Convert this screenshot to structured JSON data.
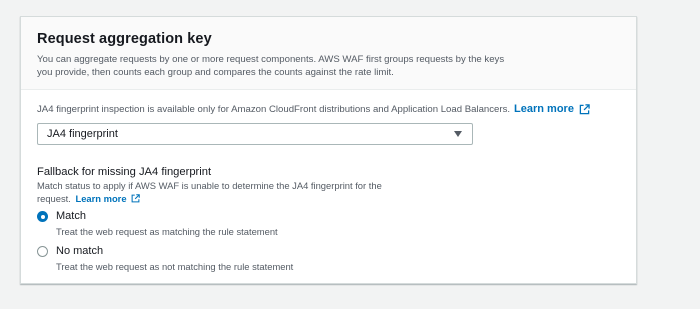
{
  "header": {
    "title": "Request aggregation key",
    "description": "You can aggregate requests by one or more request components. AWS WAF first groups requests by the keys you provide, then counts each group and compares the counts against the rate limit."
  },
  "info": {
    "text": "JA4 fingerprint inspection is available only for Amazon CloudFront distributions and Application Load Balancers.",
    "link_label": "Learn more"
  },
  "select": {
    "value": "JA4 fingerprint"
  },
  "fallback": {
    "title": "Fallback for missing JA4 fingerprint",
    "description": "Match status to apply if AWS WAF is unable to determine the JA4 fingerprint for the request.",
    "link_label": "Learn more",
    "options": [
      {
        "label": "Match",
        "description": "Treat the web request as matching the rule statement",
        "selected": true
      },
      {
        "label": "No match",
        "description": "Treat the web request as not matching the rule statement",
        "selected": false
      }
    ]
  },
  "colors": {
    "link": "#0073bb",
    "radio_selected": "#0073bb",
    "background": "#f2f3f3"
  }
}
